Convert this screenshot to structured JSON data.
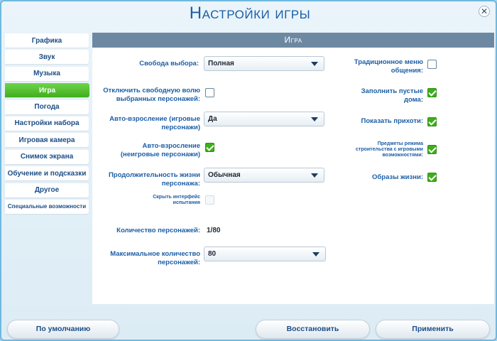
{
  "window": {
    "title": "Настройки игры"
  },
  "sidebar": {
    "items": [
      {
        "label": "Графика"
      },
      {
        "label": "Звук"
      },
      {
        "label": "Музыка"
      },
      {
        "label": "Игра",
        "active": true
      },
      {
        "label": "Погода"
      },
      {
        "label": "Настройки набора"
      },
      {
        "label": "Игровая камера"
      },
      {
        "label": "Снимок экрана"
      },
      {
        "label": "Обучение и подсказки"
      },
      {
        "label": "Другое"
      },
      {
        "label": "Специальные возможности"
      }
    ]
  },
  "panel": {
    "header": "Игра",
    "free_will": {
      "label": "Свобода выбора:",
      "value": "Полная"
    },
    "disable_free_will": {
      "label": "Отключить свободную волю выбранных персонажей:",
      "checked": false
    },
    "auto_aging_played": {
      "label": "Авто-взросление (игровые персонажи)",
      "value": "Да"
    },
    "auto_aging_unplayed": {
      "label": "Авто-взросление (неигровые персонажи)",
      "checked": true
    },
    "lifespan": {
      "label": "Продолжительность жизни персонажа:",
      "value": "Обычная"
    },
    "hide_test_ui": {
      "label": "Скрыть интерфейс испытания",
      "checked": false,
      "disabled": true
    },
    "sim_count": {
      "label": "Количество персонажей:",
      "value": "1/80"
    },
    "max_sims": {
      "label": "Максимальное количество персонажей:",
      "value": "80"
    },
    "traditional_menu": {
      "label": "Традиционное меню общения:",
      "checked": false
    },
    "fill_empty_houses": {
      "label": "Заполнить пустые дома:",
      "checked": true
    },
    "show_whims": {
      "label": "Показать прихоти:",
      "checked": true
    },
    "build_items": {
      "label": "Предметы режима строительства с игровыми возможностями:",
      "checked": true
    },
    "lifestyles": {
      "label": "Образы жизни:",
      "checked": true
    }
  },
  "footer": {
    "default_label": "По умолчанию",
    "restore_label": "Восстановить",
    "apply_label": "Применить"
  },
  "colors": {
    "accent_green": "#3fae1c",
    "title_blue": "#1a5ea8",
    "header_gray": "#6d88a1"
  }
}
